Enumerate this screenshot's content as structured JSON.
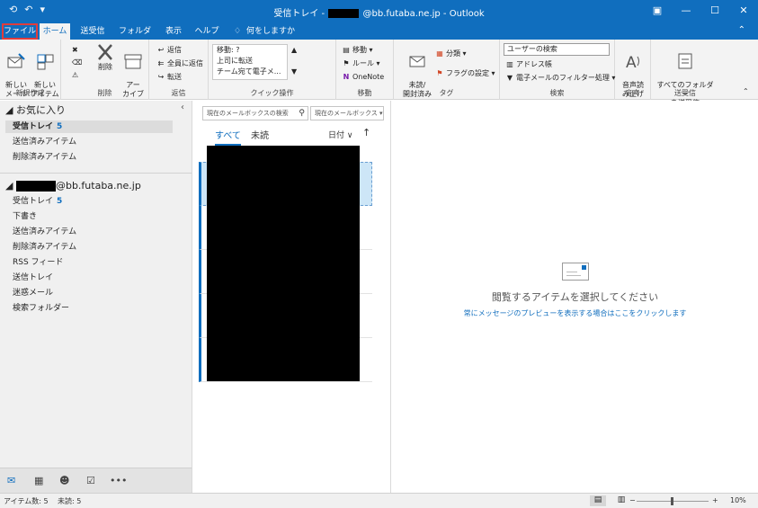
{
  "titlebar": {
    "title_prefix": "受信トレイ -",
    "title_suffix": "@bb.futaba.ne.jp  -  Outlook",
    "qat_icons": [
      "send-receive-icon",
      "undo-icon",
      "customize-icon"
    ],
    "controls": [
      "ribbon-display-icon",
      "minimize-icon",
      "maximize-icon",
      "close-icon"
    ]
  },
  "tabs": [
    {
      "label": "ファイル"
    },
    {
      "label": "ホーム"
    },
    {
      "label": "送受信"
    },
    {
      "label": "フォルダー"
    },
    {
      "label": "表示"
    },
    {
      "label": "ヘルプ"
    },
    {
      "label": "何をしますか"
    }
  ],
  "ribbon": {
    "new": {
      "new_mail": "新しい\nメール",
      "new_items": "新しい\nアイテム",
      "group": "新規作成"
    },
    "delete": {
      "delete": "削除",
      "archive": "アー\nカイブ",
      "group": "削除"
    },
    "respond": {
      "reply": "返信",
      "reply_all": "全員に返信",
      "forward": "転送",
      "group": "返信"
    },
    "quicksteps": {
      "items": [
        "移動: ?",
        "上司に転送",
        "チーム宛て電子メ..."
      ],
      "group": "クイック操作"
    },
    "move": {
      "move": "移動",
      "rules": "ルール",
      "onenote": "OneNote",
      "group": "移動"
    },
    "tags": {
      "read_unread": "未読/\n開封済み",
      "categorize": "分類",
      "followup": "フラグの設定",
      "group": "タグ"
    },
    "find": {
      "search_people_placeholder": "ユーザーの検索",
      "address_book": "アドレス帳",
      "filter_email": "電子メールのフィルター処理",
      "group": "検索"
    },
    "speech": {
      "read_aloud": "音声読\nみ上げ",
      "group": "音声"
    },
    "sendreceive": {
      "send_all": "すべてのフォルダー\nを送受信",
      "group": "送受信"
    }
  },
  "folders": {
    "favorites_header": "お気に入り",
    "favorites": [
      {
        "label": "受信トレイ",
        "count": "5"
      },
      {
        "label": "送信済みアイテム",
        "count": ""
      },
      {
        "label": "削除済みアイテム",
        "count": ""
      }
    ],
    "account_suffix": "@bb.futaba.ne.jp",
    "account_folders": [
      {
        "label": "受信トレイ",
        "count": "5"
      },
      {
        "label": "下書き",
        "count": ""
      },
      {
        "label": "送信済みアイテム",
        "count": ""
      },
      {
        "label": "削除済みアイテム",
        "count": ""
      },
      {
        "label": "RSS フィード",
        "count": ""
      },
      {
        "label": "送信トレイ",
        "count": ""
      },
      {
        "label": "迷惑メール",
        "count": ""
      },
      {
        "label": "検索フォルダー",
        "count": ""
      }
    ]
  },
  "message_list": {
    "search_placeholder": "現在のメールボックスの検索",
    "scope": "現在のメールボックス",
    "tab_all": "すべて",
    "tab_unread": "未読",
    "sort_by": "日付",
    "sort_arrow": "↑"
  },
  "reading_pane": {
    "message": "閲覧するアイテムを選択してください",
    "link": "常にメッセージのプレビューを表示する場合はここをクリックします"
  },
  "statusbar": {
    "items": "アイテム数: 5",
    "unread": "未読: 5",
    "zoom": "10%"
  },
  "colors": {
    "accent": "#106ebe",
    "highlight": "#e03c3c"
  }
}
